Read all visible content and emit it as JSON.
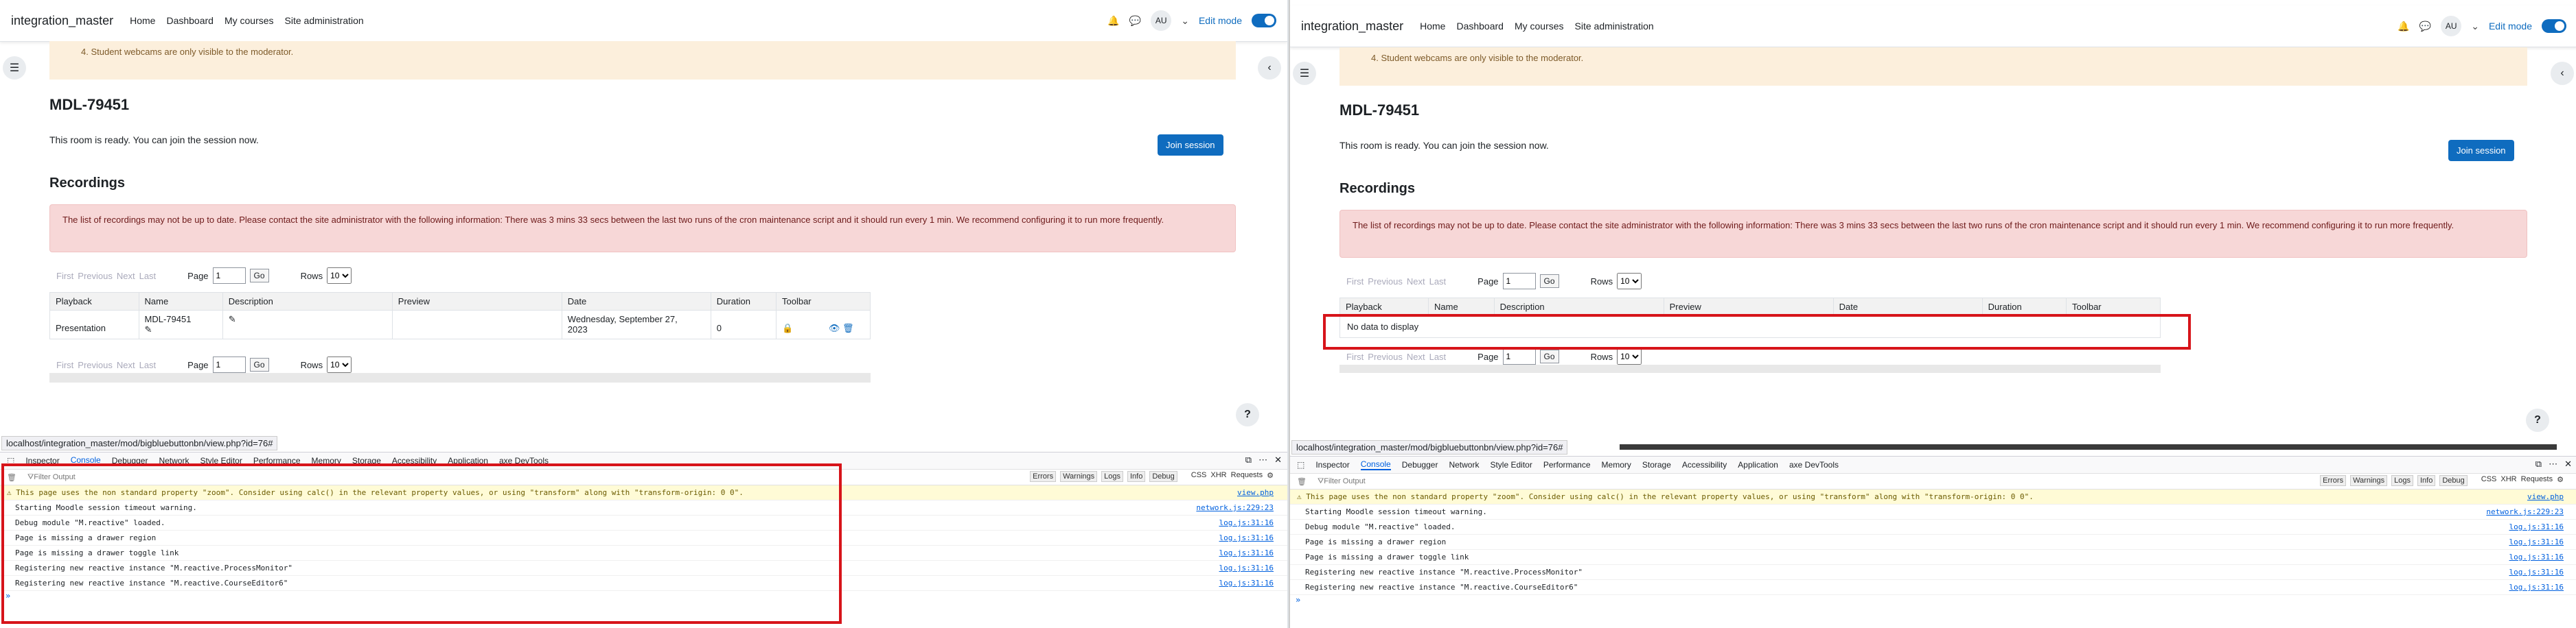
{
  "navbar": {
    "brand": "integration_master",
    "links": [
      "Home",
      "Dashboard",
      "My courses",
      "Site administration"
    ],
    "avatar": "AU",
    "edit_mode_label": "Edit mode"
  },
  "notice": {
    "text": "4. Student webcams are only visible to the moderator."
  },
  "room": {
    "title": "MDL-79451",
    "status": "This room is ready. You can join the session now.",
    "join_label": "Join session"
  },
  "recordings": {
    "heading": "Recordings",
    "alert": "The list of recordings may not be up to date. Please contact the site administrator with the following information: There was 3 mins 33 secs between the last two runs of the cron maintenance script and it should run every 1 min. We recommend configuring it to run more frequently."
  },
  "pager": {
    "first": "First",
    "previous": "Previous",
    "next": "Next",
    "last": "Last",
    "page_label": "Page",
    "page_value": "1",
    "go": "Go",
    "rows_label": "Rows",
    "rows_value": "10"
  },
  "table": {
    "headers": [
      "Playback",
      "Name",
      "Description",
      "Preview",
      "Date",
      "Duration",
      "Toolbar"
    ],
    "row": {
      "playback": "Presentation",
      "name": "MDL-79451",
      "date_line1": "Wednesday, September 27,",
      "date_line2": "2023",
      "duration": "0"
    },
    "empty": "No data to display"
  },
  "help": "?",
  "status_url": "localhost/integration_master/mod/bigbluebuttonbn/view.php?id=76#",
  "devtools": {
    "tabs": [
      "Inspector",
      "Console",
      "Debugger",
      "Network",
      "Style Editor",
      "Performance",
      "Memory",
      "Storage",
      "Accessibility",
      "Application",
      "axe DevTools"
    ],
    "filter_placeholder": "Filter Output",
    "levels": [
      "Errors",
      "Warnings",
      "Logs",
      "Info",
      "Debug"
    ],
    "extras": [
      "CSS",
      "XHR",
      "Requests"
    ],
    "messages": [
      {
        "text": "This page uses the non standard property \"zoom\". Consider using calc() in the relevant property values, or using \"transform\" along with \"transform-origin: 0 0\".",
        "src": "view.php"
      },
      {
        "text": "Starting Moodle session timeout warning.",
        "src": "network.js:229:23"
      },
      {
        "text": "Debug module \"M.reactive\" loaded.",
        "src": "log.js:31:16"
      },
      {
        "text": "Page is missing a drawer region",
        "src": "log.js:31:16"
      },
      {
        "text": "Page is missing a drawer toggle link",
        "src": "log.js:31:16"
      },
      {
        "text": "Registering new reactive instance \"M.reactive.ProcessMonitor\"",
        "src": "log.js:31:16"
      },
      {
        "text": "Registering new reactive instance \"M.reactive.CourseEditor6\"",
        "src": "log.js:31:16"
      }
    ],
    "prompt": "»"
  },
  "colors": {
    "primary": "#0f6cbf",
    "highlight": "#d7141a",
    "alert_bg": "#f7d7d7",
    "notice_bg": "#fcefdc"
  }
}
